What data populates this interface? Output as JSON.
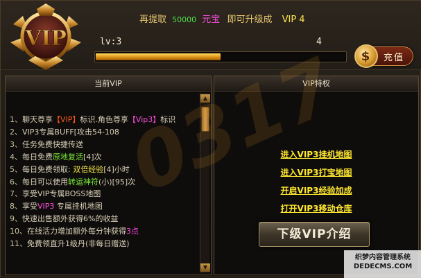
{
  "header": {
    "notice_prefix": "再提取",
    "notice_amount": "50000",
    "notice_currency": "元宝",
    "notice_middle": "即可升级成",
    "notice_target": "VIP 4",
    "level_label": "lv:3",
    "next_level": "4",
    "progress": 0.5,
    "recharge_label": "充值",
    "coin_symbol": "$",
    "emblem_text": "VIP"
  },
  "left_panel": {
    "title": "当前VIP",
    "perks": [
      {
        "num": "1、",
        "parts": [
          {
            "t": "聊天尊享",
            "c": ""
          },
          {
            "t": "【VIP】",
            "c": "hl-orange"
          },
          {
            "t": "标识.角色尊享",
            "c": ""
          },
          {
            "t": "【Vip3】",
            "c": "hl-pink"
          },
          {
            "t": "标识",
            "c": ""
          }
        ]
      },
      {
        "num": "2、",
        "parts": [
          {
            "t": "VIP3专属BUFF[攻击54-108",
            "c": ""
          }
        ]
      },
      {
        "num": "3、",
        "parts": [
          {
            "t": "任务免费快捷传送",
            "c": ""
          }
        ]
      },
      {
        "num": "4、",
        "parts": [
          {
            "t": "每日免费",
            "c": ""
          },
          {
            "t": "原地复活",
            "c": "hl-green"
          },
          {
            "t": "[4]次",
            "c": ""
          }
        ]
      },
      {
        "num": "5、",
        "parts": [
          {
            "t": "每日免费领取: ",
            "c": ""
          },
          {
            "t": "双倍经验",
            "c": "hl-yellow"
          },
          {
            "t": "[4]小时",
            "c": ""
          }
        ]
      },
      {
        "num": "6、",
        "parts": [
          {
            "t": "每日可以使用",
            "c": ""
          },
          {
            "t": "转运神符",
            "c": "hl-green"
          },
          {
            "t": "(小)[95]次",
            "c": ""
          }
        ]
      },
      {
        "num": "7、",
        "parts": [
          {
            "t": "享受VIP专属BOSS地图",
            "c": ""
          }
        ]
      },
      {
        "num": "8、",
        "parts": [
          {
            "t": "享受",
            "c": ""
          },
          {
            "t": "VIP3",
            "c": "hl-pink"
          },
          {
            "t": " 专属挂机地图",
            "c": ""
          }
        ]
      },
      {
        "num": "9、",
        "parts": [
          {
            "t": "快速出售额外获得6%的收益",
            "c": ""
          }
        ]
      },
      {
        "num": "10、",
        "parts": [
          {
            "t": "在线活力增加额外每分钟获得",
            "c": ""
          },
          {
            "t": "3点",
            "c": "hl-pink"
          }
        ]
      },
      {
        "num": "11、",
        "parts": [
          {
            "t": "免费领直升1级丹(非每日赠送)",
            "c": ""
          }
        ]
      }
    ],
    "scroll_up": "▲",
    "scroll_down": "▼"
  },
  "right_panel": {
    "title": "VIP特权",
    "links": [
      "进入VIP3挂机地图",
      "进入VIP3打宝地图",
      "开启VIP3经验加成",
      "打开VIP3移动仓库"
    ],
    "next_vip_label": "下级VIP介绍"
  },
  "watermark": "0317",
  "site_mark": {
    "line1": "织梦内容管理系统",
    "line2": "DEDECMS.COM"
  },
  "colors": {
    "accent_gold": "#e8c870",
    "link_yellow": "#ffe830",
    "amount_green": "#4fe04f",
    "currency_pink": "#ff4de0"
  }
}
